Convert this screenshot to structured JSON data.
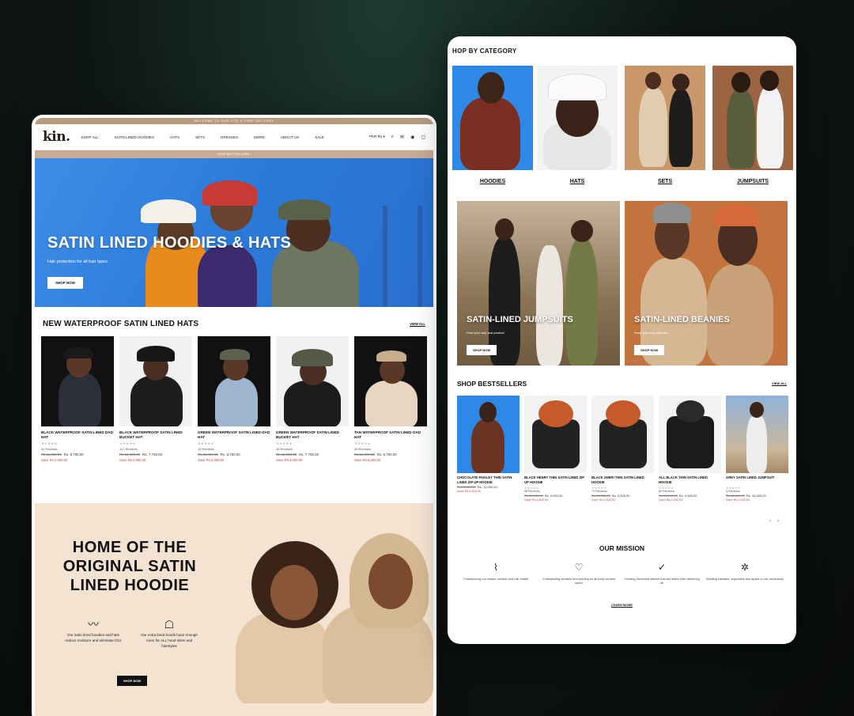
{
  "left_site": {
    "announcement": "WELCOME TO OUR SITE & FREE DELIVERY",
    "logo": "kin.",
    "nav": [
      "SHOP ALL",
      "SATIN LINED HOODIES",
      "HATS",
      "SETS",
      "DRESSES",
      "MORE",
      "ABOUT US",
      "SALE"
    ],
    "currency": "PKR Rs ▾",
    "sub_strip": "SHOP BESTSELLERS ›",
    "hero": {
      "title": "SATIN LINED HOODIES & HATS",
      "subtitle": "Hair protection for all hair types",
      "button": "SHOP NOW"
    },
    "section_title": "NEW WATERPROOF SATIN LINED HATS",
    "view_all": "VIEW ALL",
    "products": [
      {
        "name": "BLACK WATERPROOF SATIN LINED DAD HAT",
        "stars": "★★★★★",
        "reviews": "41 Reviews",
        "old_price": "Rs.11,000.00",
        "price": "Rs. 6,700.00",
        "save": "Save Rs.4,300.00"
      },
      {
        "name": "BLACK WATERPROOF SATIN LINED BUCKET HAT",
        "stars": "★★★★★",
        "reviews": "117 Reviews",
        "old_price": "Rs.12,000.00",
        "price": "Rs. 7,700.00",
        "save": "Save Rs.4,300.00"
      },
      {
        "name": "GREEN WATERPROOF SATIN LINED DAD HAT",
        "stars": "★★★★★",
        "reviews": "19 Reviews",
        "old_price": "Rs.11,000.00",
        "price": "Rs. 6,700.00",
        "save": "Save Rs.4,300.00"
      },
      {
        "name": "GREEN WATERPROOF SATIN LINED BUCKET HAT",
        "stars": "★★★★★",
        "reviews": "35 Reviews",
        "old_price": "Rs.12,000.00",
        "price": "Rs. 7,700.00",
        "save": "Save Rs.4,300.00"
      },
      {
        "name": "TAN WATERPROOF SATIN LINED DAD HAT",
        "stars": "★★★★★",
        "reviews": "28 Reviews",
        "old_price": "Rs.11,000.00",
        "price": "Rs. 6,700.00",
        "save": "Save Rs.4,300.00"
      }
    ],
    "feature": {
      "title": "HOME OF THE ORIGINAL SATIN LINED HOODIE",
      "col1": "Our satin lined hoodies and hats reduce moisture and eliminate frizz",
      "col2": "Our extra lined hoods have enough room for ALL hood sizes and hairstyles",
      "button": "SHOP NOW"
    }
  },
  "right_site": {
    "category_title": "HOP BY CATEGORY",
    "categories": [
      "HOODIES",
      "HATS",
      "SETS",
      "JUMPSUITS"
    ],
    "cards": [
      {
        "title": "SATIN-LINED JUMPSUITS",
        "subtitle": "Free your way and product",
        "button": "SHOP NOW"
      },
      {
        "title": "SATIN-LINED BEANIES",
        "subtitle": "Keep your way and hair",
        "button": "SHOP NOW"
      }
    ],
    "bestsellers_title": "SHOP BESTSELLERS",
    "view_all": "VIEW ALL",
    "bestsellers": [
      {
        "name": "CHOCOLATE PAISLEY THIN SATIN LINED ZIP UP HOODIE",
        "stars": "",
        "reviews": "",
        "old_price": "Rs.13,000.00",
        "price": "Rs. 10,000.00",
        "save": "Save Rs.3,000.00"
      },
      {
        "name": "BLACK HENRY THIN SATIN LINED ZIP UP HOODIE",
        "stars": "★★★★★",
        "reviews": "56 Reviews",
        "old_price": "Rs.13,000.00",
        "price": "Rs. 9,500.00",
        "save": "Save Rs.3,500.00"
      },
      {
        "name": "BLACK SHERI THIN SATIN LINED HOODIE",
        "stars": "★★★★★",
        "reviews": "71 Reviews",
        "old_price": "Rs.13,000.00",
        "price": "Rs. 9,500.00",
        "save": "Save Rs.3,500.00"
      },
      {
        "name": "ALL BLACK THIN SATIN LINED HOODIE",
        "stars": "★★★★★",
        "reviews": "60 Reviews",
        "old_price": "Rs.13,000.00",
        "price": "Rs. 9,500.00",
        "save": "Save Rs.3,500.00"
      },
      {
        "name": "GREY SATIN LINED JUMPSUIT",
        "stars": "★★★★★",
        "reviews": "4 Reviews",
        "old_price": "Rs.18,000.00",
        "price": "Rs. 16,000.00",
        "save": "Save Rs.2,000.00"
      }
    ],
    "mission_title": "OUR MISSION",
    "mission": [
      "Championing our unique melanin and hair health",
      "Championing sensible and clothing for all body comfort styles",
      "Creating functional fashion that are better than delivering all",
      "Building inclusive, supportive and space to our community"
    ],
    "learn_more": "LEARN MORE"
  }
}
